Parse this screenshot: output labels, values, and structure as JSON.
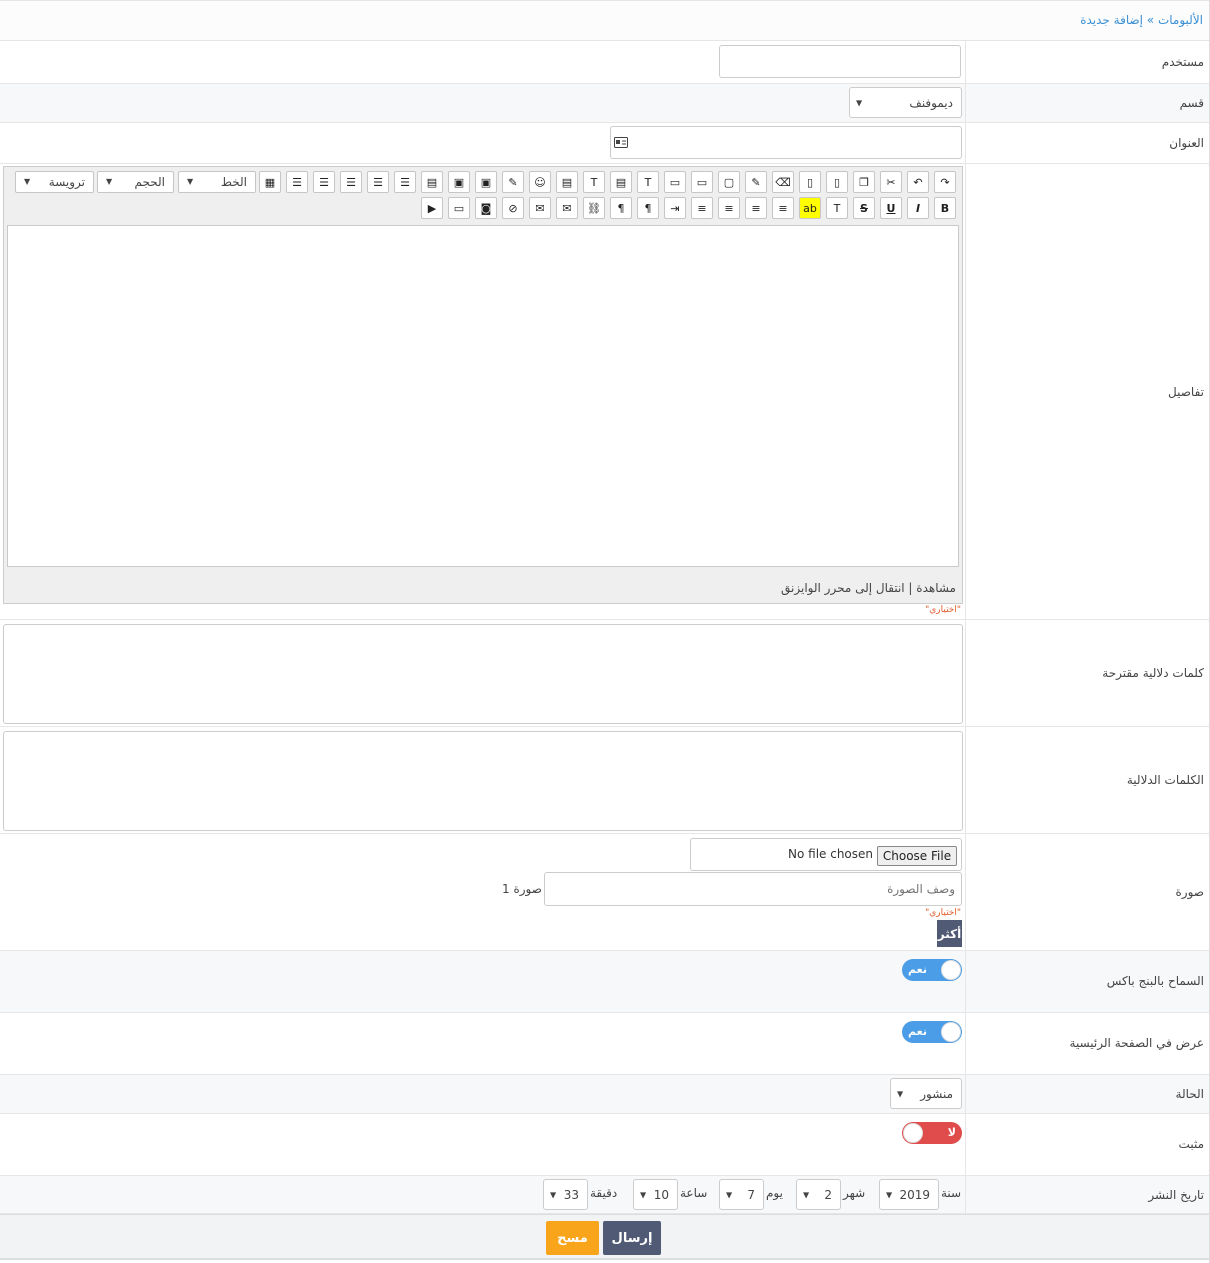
{
  "breadcrumb": {
    "text": "الألبومات » إضافة جديدة"
  },
  "fields": {
    "user": {
      "label": "مستخدم",
      "value": ""
    },
    "category": {
      "label": "قسم",
      "value": "ديموفنف"
    },
    "title": {
      "label": "العنوان",
      "value": ""
    },
    "details": {
      "label": "تفاصيل"
    },
    "suggested_tags": {
      "label": "كلمات دلالية مقترحة"
    },
    "tags": {
      "label": "الكلمات الدلالية"
    },
    "image": {
      "label": "صورة",
      "file_button": "Choose File",
      "file_status": "No file chosen",
      "desc_placeholder": "وصف الصورة",
      "index_label": "صورة 1",
      "more_button": "أكثر"
    },
    "allow_pingback": {
      "label": "السماح بالبنج باكس",
      "value": "نعم"
    },
    "show_home": {
      "label": "عرض في الصفحة الرئيسية",
      "value": "نعم"
    },
    "status": {
      "label": "الحالة",
      "value": "منشور"
    },
    "pinned": {
      "label": "مثبت",
      "value": "لا"
    },
    "publish_date": {
      "label": "تاريخ النشر",
      "year_label": "سنة",
      "year": "2019",
      "month_label": "شهر",
      "month": "2",
      "day_label": "يوم",
      "day": "7",
      "hour_label": "ساعة",
      "hour": "10",
      "minute_label": "دقيقة",
      "minute": "33"
    }
  },
  "editor": {
    "heading_select": "ترويسة",
    "size_select": "الحجم",
    "font_select": "الخط",
    "status_text": "مشاهدة | انتقال إلى محرر الوايزنق",
    "optional_note": "\"اختياري\""
  },
  "image_optional_note": "\"اختياري\"",
  "buttons": {
    "submit": "إرسال",
    "reset": "مسح"
  },
  "colors": {
    "link": "#3b8fd3",
    "toggle_on": "#4a9de6",
    "toggle_off": "#e04b4b",
    "submit": "#505a74",
    "reset": "#f8a51c",
    "optional": "#e05a2a"
  }
}
